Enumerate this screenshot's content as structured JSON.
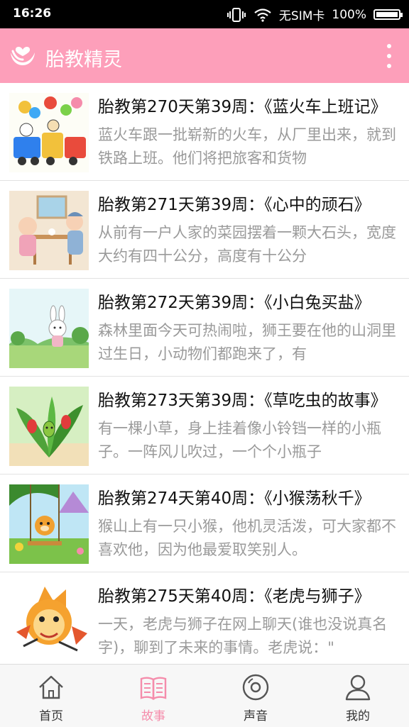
{
  "status_bar": {
    "time": "16:26",
    "sim": "无SIM卡",
    "battery": "100%",
    "battery_level": 1.0,
    "icons": [
      "vibrate-icon",
      "wifi-icon",
      "battery-icon"
    ]
  },
  "app_bar": {
    "title": "胎教精灵",
    "accent_color": "#fd9fba"
  },
  "stories": [
    {
      "title": "胎教第270天第39周：《蓝火车上班记》",
      "desc": "蓝火车跟一批崭新的火车，从厂里出来，就到铁路上班。他们将把旅客和货物"
    },
    {
      "title": "胎教第271天第39周：《心中的顽石》",
      "desc": "从前有一户人家的菜园摆着一颗大石头，宽度大约有四十公分，高度有十公分"
    },
    {
      "title": "胎教第272天第39周：《小白兔买盐》",
      "desc": "森林里面今天可热闹啦，狮王要在他的山洞里过生日，小动物们都跑来了，有"
    },
    {
      "title": "胎教第273天第39周：《草吃虫的故事》",
      "desc": "有一棵小草，身上挂着像小铃铛一样的小瓶子。一阵风儿吹过，一个个小瓶子"
    },
    {
      "title": "胎教第274天第40周：《小猴荡秋千》",
      "desc": "猴山上有一只小猴，他机灵活泼，可大家都不喜欢他，因为他最爱取笑别人。"
    },
    {
      "title": "胎教第275天第40周：《老虎与狮子》",
      "desc": "一天，老虎与狮子在网上聊天(谁也没说真名字)，聊到了未来的事情。老虎说：\""
    }
  ],
  "bottom_nav": [
    {
      "label": "首页",
      "icon": "home-icon"
    },
    {
      "label": "故事",
      "icon": "book-icon",
      "active": true
    },
    {
      "label": "声音",
      "icon": "disc-icon"
    },
    {
      "label": "我的",
      "icon": "user-icon"
    }
  ]
}
